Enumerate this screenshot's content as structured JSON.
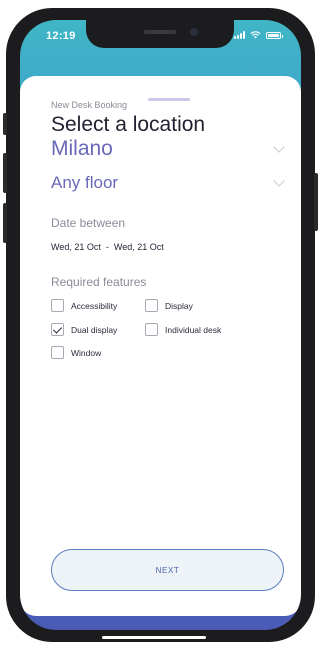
{
  "status_bar": {
    "time": "12:19",
    "signal_icon": "signal-bars-icon",
    "wifi_icon": "wifi-icon",
    "battery_icon": "battery-icon"
  },
  "sheet": {
    "overline": "New Desk Booking",
    "title": "Select a location",
    "location": {
      "value": "Milano",
      "icon": "chevron-down-icon"
    },
    "floor": {
      "value": "Any floor",
      "icon": "chevron-down-icon"
    },
    "dates": {
      "label": "Date between",
      "from": "Wed, 21 Oct",
      "separator": "-",
      "to": "Wed, 21 Oct"
    },
    "features": {
      "label": "Required features",
      "options": [
        {
          "label": "Accessibility",
          "checked": false
        },
        {
          "label": "Display",
          "checked": false
        },
        {
          "label": "Dual display",
          "checked": true
        },
        {
          "label": "Individual desk",
          "checked": false
        },
        {
          "label": "Window",
          "checked": false
        }
      ]
    },
    "next_label": "NEXT"
  },
  "colors": {
    "accent": "#6a68b8",
    "button_border": "#5e7cc0",
    "gradient_top": "#3fb6c6",
    "gradient_bottom": "#4a5bb6"
  }
}
